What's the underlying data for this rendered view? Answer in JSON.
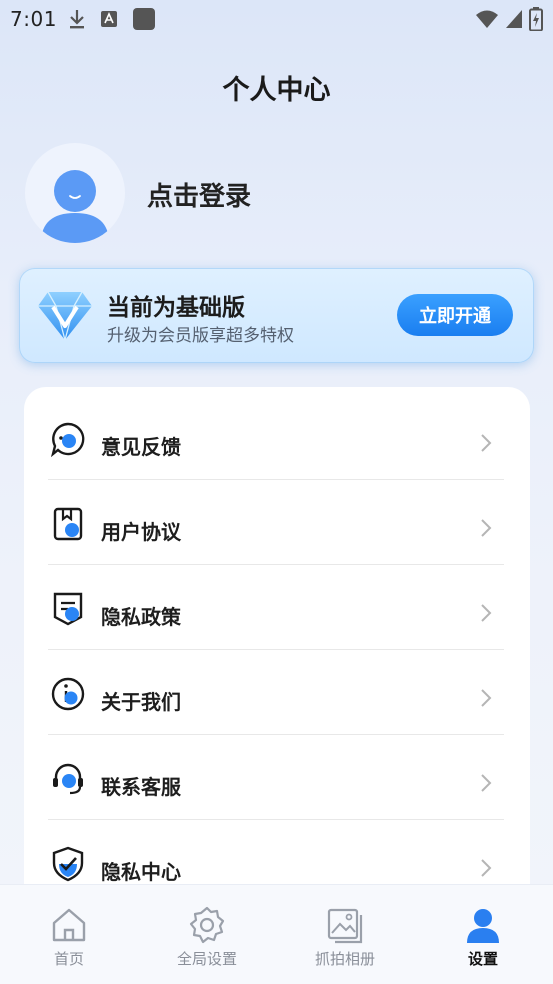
{
  "status_bar": {
    "time": "7:01",
    "left_icons": [
      "download-icon",
      "font-icon",
      "app-square-icon"
    ],
    "right_icons": [
      "wifi-icon",
      "signal-icon",
      "battery-charging-icon"
    ]
  },
  "header": {
    "title": "个人中心"
  },
  "profile": {
    "login_label": "点击登录"
  },
  "vip": {
    "title": "当前为基础版",
    "subtitle": "升级为会员版享超多特权",
    "button_label": "立即开通",
    "accent": "#1a7ef0"
  },
  "menu": {
    "items": [
      {
        "label": "意见反馈",
        "icon": "feedback-chat-icon"
      },
      {
        "label": "用户协议",
        "icon": "user-agreement-icon"
      },
      {
        "label": "隐私政策",
        "icon": "privacy-policy-icon"
      },
      {
        "label": "关于我们",
        "icon": "info-icon"
      },
      {
        "label": "联系客服",
        "icon": "headset-icon"
      },
      {
        "label": "隐私中心",
        "icon": "shield-check-icon"
      }
    ]
  },
  "bottom_nav": {
    "items": [
      {
        "label": "首页",
        "icon": "home-icon",
        "active": false
      },
      {
        "label": "全局设置",
        "icon": "gear-icon",
        "active": false
      },
      {
        "label": "抓拍相册",
        "icon": "gallery-icon",
        "active": false
      },
      {
        "label": "设置",
        "icon": "person-icon",
        "active": true
      }
    ]
  }
}
